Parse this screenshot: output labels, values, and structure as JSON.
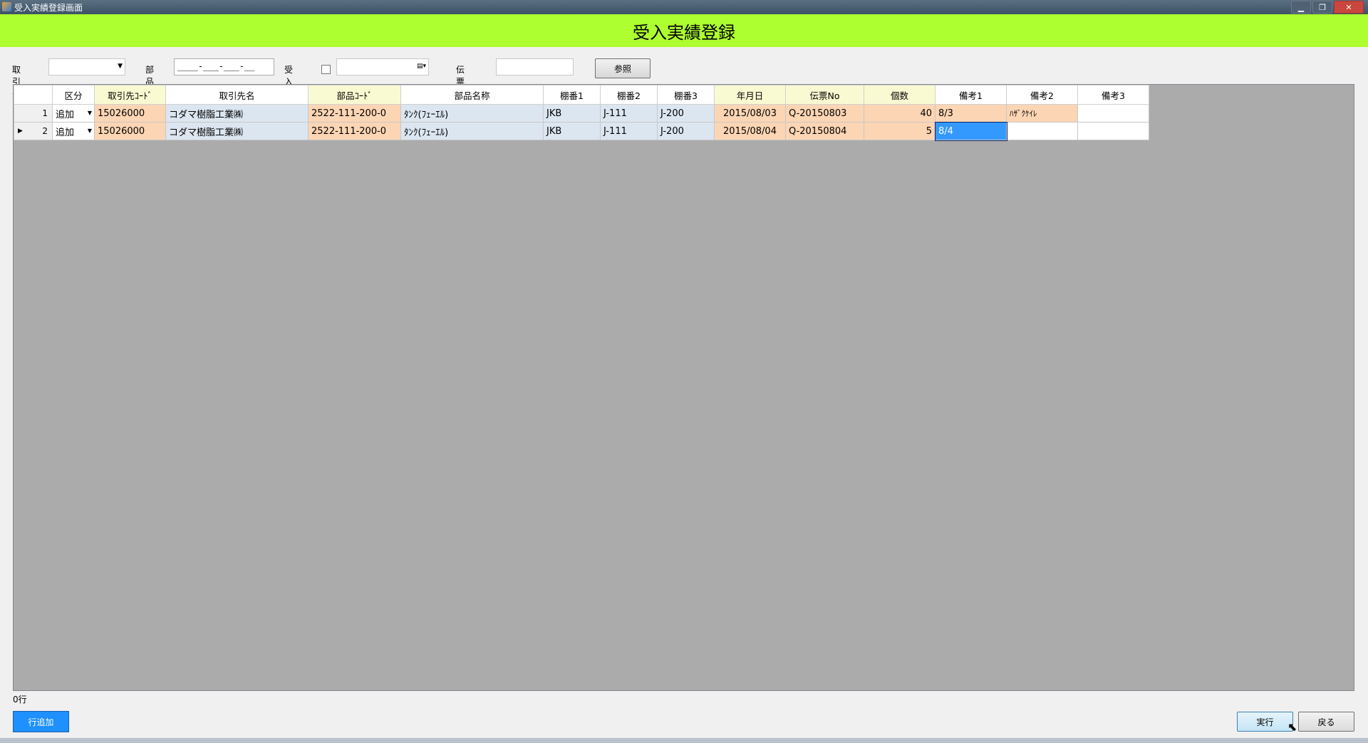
{
  "window": {
    "title": "受入実績登録画面",
    "controls": [
      "▁",
      "❐",
      "✕"
    ]
  },
  "header": {
    "title": "受入実績登録"
  },
  "filters": {
    "supplier_label": "取引先",
    "part_label": "部品",
    "part_mask": "____-___-___-__",
    "date_label": "受入日",
    "slip_label": "伝票No",
    "ref_button": "参照"
  },
  "grid": {
    "columns": [
      "区分",
      "取引先ｺｰﾄﾞ",
      "取引先名",
      "部品ｺｰﾄﾞ",
      "部品名称",
      "棚番1",
      "棚番2",
      "棚番3",
      "年月日",
      "伝票No",
      "個数",
      "備考1",
      "備考2",
      "備考3"
    ],
    "rows": [
      {
        "no": "1",
        "kubun": "追加",
        "sup_code": "15026000",
        "sup_name": "コダマ樹脂工業㈱",
        "part_code": "2522-111-200-0",
        "part_name": "ﾀﾝｸ(ﾌｪｰｴﾙ)",
        "tana1": "JKB",
        "tana2": "J-111",
        "tana3": "J-200",
        "date": "2015/08/03",
        "slip": "Q-20150803",
        "qty": "40",
        "note1": "8/3",
        "note2": "ﾊｻﾞｸｹｲﾚ",
        "note3": ""
      },
      {
        "no": "2",
        "kubun": "追加",
        "sup_code": "15026000",
        "sup_name": "コダマ樹脂工業㈱",
        "part_code": "2522-111-200-0",
        "part_name": "ﾀﾝｸ(ﾌｪｰｴﾙ)",
        "tana1": "JKB",
        "tana2": "J-111",
        "tana3": "J-200",
        "date": "2015/08/04",
        "slip": "Q-20150804",
        "qty": "5",
        "note1": "8/4",
        "note2": "",
        "note3": ""
      }
    ]
  },
  "status": {
    "row_count": "0行"
  },
  "buttons": {
    "add_row": "行追加",
    "execute": "実行",
    "back": "戻る"
  }
}
